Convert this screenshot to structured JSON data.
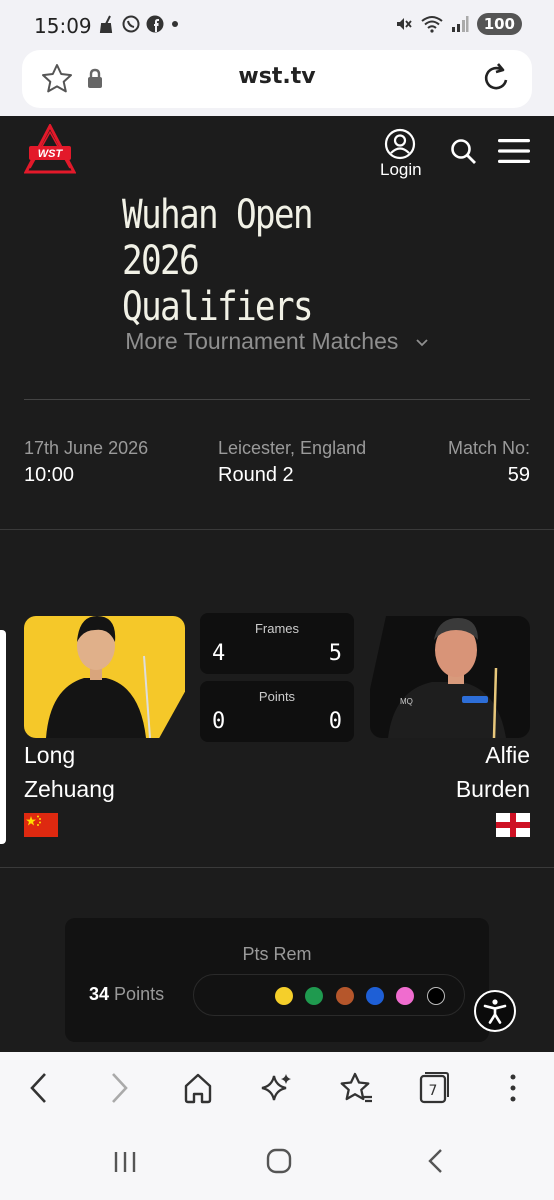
{
  "status_bar": {
    "time": "15:09",
    "battery": "100",
    "left_icons": [
      "broom-icon",
      "whatsapp-icon",
      "facebook-icon",
      "dot-icon"
    ],
    "right_icons": [
      "mute-icon",
      "wifi-icon",
      "signal-icon"
    ]
  },
  "browser": {
    "url": "wst.tv"
  },
  "site": {
    "logo_text": "WST",
    "login_label": "Login"
  },
  "tournament": {
    "title_line1": "Wuhan Open 2026",
    "title_line2": "Qualifiers",
    "more_matches": "More Tournament Matches"
  },
  "match": {
    "date": "17th June 2026",
    "time": "10:00",
    "venue": "Leicester, England",
    "round": "Round 2",
    "match_no_label": "Match No:",
    "match_no": "59"
  },
  "score": {
    "frames_label": "Frames",
    "frames_left": "4",
    "frames_right": "5",
    "points_label": "Points",
    "points_left": "0",
    "points_right": "0"
  },
  "players": {
    "left": {
      "first": "Long",
      "last": "Zehuang",
      "country_flag": "china-flag"
    },
    "right": {
      "first": "Alfie",
      "last": "Burden",
      "country_flag": "england-flag"
    }
  },
  "points_remaining": {
    "label": "Pts Rem",
    "value": "34",
    "unit": "Points",
    "balls": [
      "#f5cf2a",
      "#1f9a4f",
      "#b5562b",
      "#1e5fd6",
      "#f06ccf",
      "#000000"
    ]
  },
  "colors": {
    "page_bg": "#1c1c1c",
    "accent_red": "#e3192a",
    "player_card_yellow": "#f5c829"
  }
}
